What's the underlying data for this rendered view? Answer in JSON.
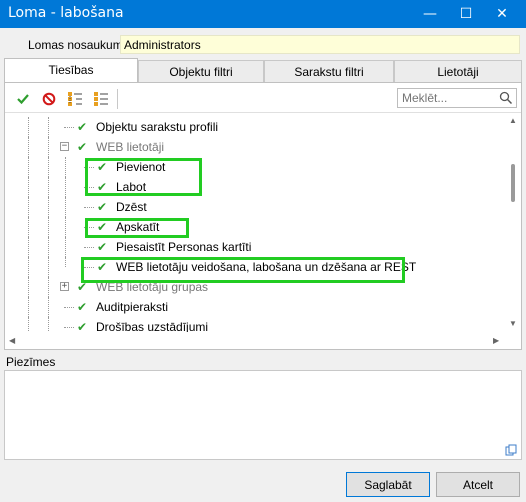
{
  "window": {
    "title": "Loma - labošana",
    "minimize_glyph": "—",
    "maximize_glyph": "☐",
    "close_glyph": "✕"
  },
  "role_name": {
    "label": "Lomas nosaukums:",
    "value": "Administrators"
  },
  "tabs": [
    {
      "label": "Tiesības",
      "active": true
    },
    {
      "label": "Objektu filtri",
      "active": false
    },
    {
      "label": "Sarakstu filtri",
      "active": false
    },
    {
      "label": "Lietotāji",
      "active": false
    }
  ],
  "toolbar": {
    "check_all_icon": "check-icon",
    "uncheck_all_icon": "no-entry-icon",
    "expand_all_icon": "tree-expand-icon",
    "collapse_all_icon": "tree-collapse-icon",
    "search_placeholder": "Meklēt...",
    "search_icon": "magnifier-icon"
  },
  "tree": [
    {
      "label": "Objektu sarakstu profili",
      "checked": true,
      "grey": false
    },
    {
      "label": "WEB lietotāji",
      "checked": true,
      "grey": true,
      "expander": "−"
    },
    {
      "label": "Pievienot",
      "checked": true,
      "grey": false
    },
    {
      "label": "Labot",
      "checked": true,
      "grey": false
    },
    {
      "label": "Dzēst",
      "checked": true,
      "grey": false
    },
    {
      "label": "Apskatīt",
      "checked": true,
      "grey": false
    },
    {
      "label": "Piesaistīt Personas kartīti",
      "checked": true,
      "grey": false
    },
    {
      "label": "WEB lietotāju veidošana, labošana un dzēšana ar REST",
      "checked": true,
      "grey": false
    },
    {
      "label": "WEB lietotāju grupas",
      "checked": true,
      "grey": true,
      "expander": "+"
    },
    {
      "label": "Auditpieraksti",
      "checked": true,
      "grey": false
    },
    {
      "label": "Drošības uzstādījumi",
      "checked": true,
      "grey": false
    }
  ],
  "colors": {
    "check": "#2e9e2e",
    "highlight": "#22cc22",
    "titlebar": "#0078d7",
    "name_field": "#fefed8"
  },
  "notes": {
    "label": "Piezīmes",
    "value": ""
  },
  "footer": {
    "save_label": "Saglabāt",
    "cancel_label": "Atcelt"
  }
}
